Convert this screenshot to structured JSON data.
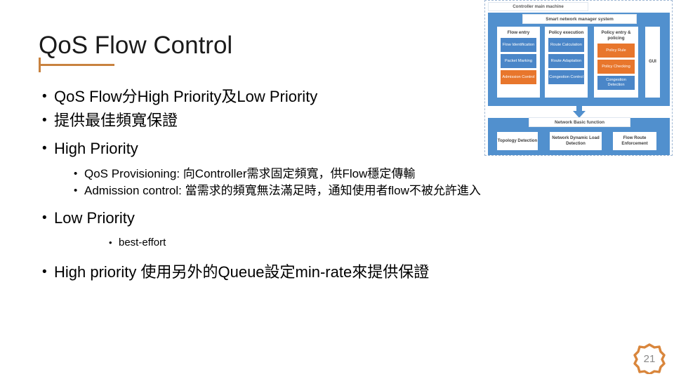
{
  "slide": {
    "title": "QoS Flow Control",
    "page_number": "21",
    "accent_color": "#C8823F",
    "diagram_blue": "#5190CE",
    "diagram_chip_blue": "#4A86C8",
    "diagram_orange": "#E8762C"
  },
  "bullet_glyph": "•",
  "body": {
    "items": [
      {
        "level": 1,
        "text": "QoS Flow分High Priority及Low Priority"
      },
      {
        "level": 1,
        "text": "提供最佳頻寬保證"
      },
      {
        "level": 1,
        "text": "High Priority"
      },
      {
        "level": 2,
        "text": "QoS Provisioning: 向Controller需求固定頻寬，供Flow穩定傳輸"
      },
      {
        "level": 2,
        "text": "Admission control: 當需求的頻寬無法滿足時，通知使用者flow不被允許進入"
      },
      {
        "level": 1,
        "text": "Low Priority"
      },
      {
        "level": 3,
        "text": "best-effort"
      },
      {
        "level": 1,
        "text": "High priority 使用另外的Queue設定min-rate來提供保證"
      }
    ]
  },
  "diagram": {
    "outer_label": "Controller main machine",
    "smart_system_label": "Smart network manager system",
    "gui_label": "GUI",
    "columns": [
      {
        "heading": "Flow entry",
        "chips": [
          {
            "label": "Flow Identification",
            "color": "blue"
          },
          {
            "label": "Packet Marking",
            "color": "blue"
          },
          {
            "label": "Admission Control",
            "color": "orange"
          }
        ]
      },
      {
        "heading": "Policy execution",
        "chips": [
          {
            "label": "Route Calculation",
            "color": "blue"
          },
          {
            "label": "Route Adaptation",
            "color": "blue"
          },
          {
            "label": "Congestion Control",
            "color": "blue"
          }
        ]
      },
      {
        "heading": "Policy entry & policing",
        "chips": [
          {
            "label": "Policy Rule",
            "color": "orange"
          },
          {
            "label": "Policy Checking",
            "color": "orange"
          },
          {
            "label": "Congestion Detection",
            "color": "blue"
          }
        ]
      }
    ],
    "basic_function_label": "Network Basic function",
    "basic_boxes": [
      "Topology Detection",
      "Network Dynamic Load Detection",
      "Flow Route Enforcement"
    ]
  }
}
